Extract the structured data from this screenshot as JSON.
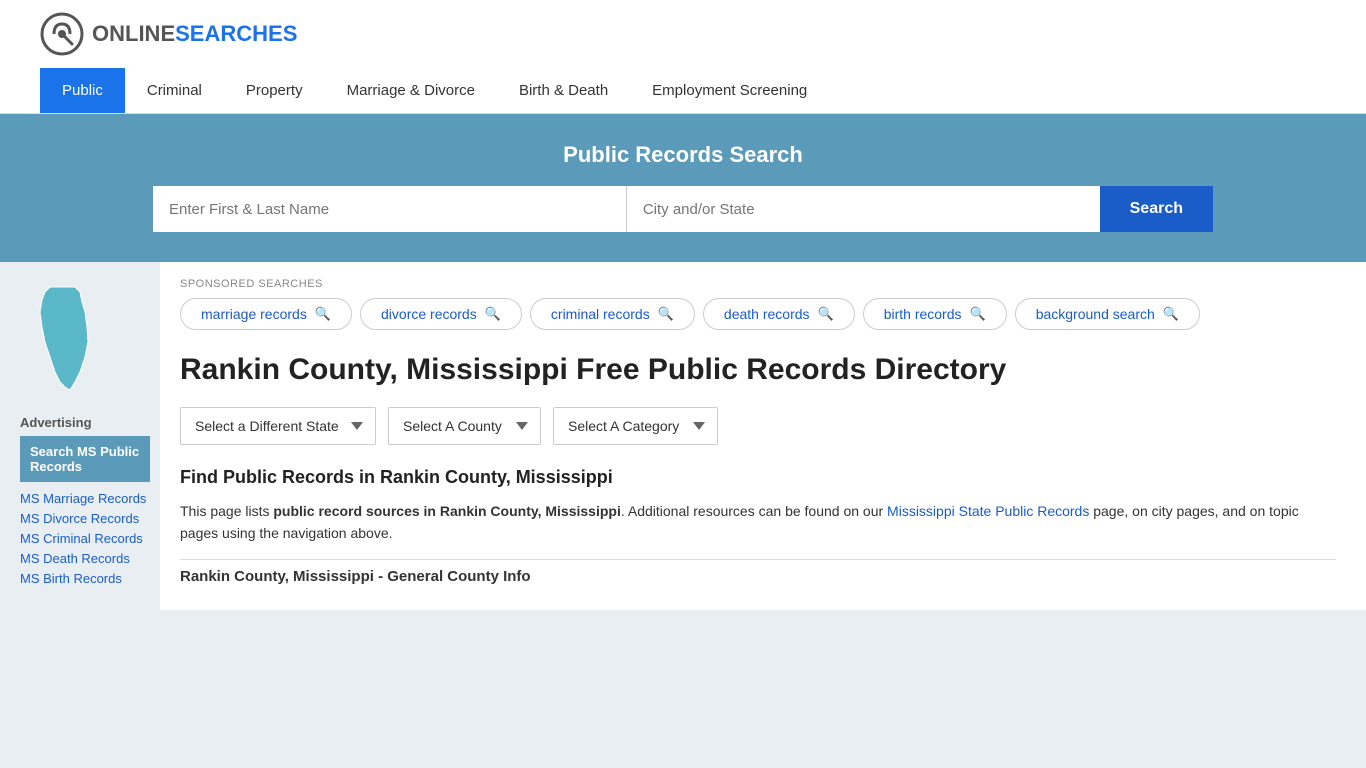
{
  "site": {
    "logo_text_gray": "ONLINE",
    "logo_text_blue": "SEARCHES"
  },
  "nav": {
    "items": [
      {
        "label": "Public",
        "active": true
      },
      {
        "label": "Criminal",
        "active": false
      },
      {
        "label": "Property",
        "active": false
      },
      {
        "label": "Marriage & Divorce",
        "active": false
      },
      {
        "label": "Birth & Death",
        "active": false
      },
      {
        "label": "Employment Screening",
        "active": false
      }
    ]
  },
  "search_banner": {
    "title": "Public Records Search",
    "name_placeholder": "Enter First & Last Name",
    "location_placeholder": "City and/or State",
    "button_label": "Search"
  },
  "sponsored": {
    "label": "SPONSORED SEARCHES",
    "tags": [
      {
        "text": "marriage records"
      },
      {
        "text": "divorce records"
      },
      {
        "text": "criminal records"
      },
      {
        "text": "death records"
      },
      {
        "text": "birth records"
      },
      {
        "text": "background search"
      }
    ]
  },
  "page": {
    "title": "Rankin County, Mississippi Free Public Records Directory",
    "dropdowns": {
      "state_label": "Select a Different State",
      "county_label": "Select A County",
      "category_label": "Select A Category"
    },
    "find_title": "Find Public Records in Rankin County, Mississippi",
    "find_text_1": "This page lists ",
    "find_text_bold": "public record sources in Rankin County, Mississippi",
    "find_text_2": ". Additional resources can be found on our ",
    "find_link": "Mississippi State Public Records",
    "find_text_3": " page, on city pages, and on topic pages using the navigation above.",
    "county_info_title": "Rankin County, Mississippi - General County Info"
  },
  "sidebar": {
    "advertising_label": "Advertising",
    "ad_box": "Search MS Public Records",
    "links": [
      {
        "text": "MS Marriage Records"
      },
      {
        "text": "MS Divorce Records"
      },
      {
        "text": "MS Criminal Records"
      },
      {
        "text": "MS Death Records"
      },
      {
        "text": "MS Birth Records"
      }
    ]
  }
}
